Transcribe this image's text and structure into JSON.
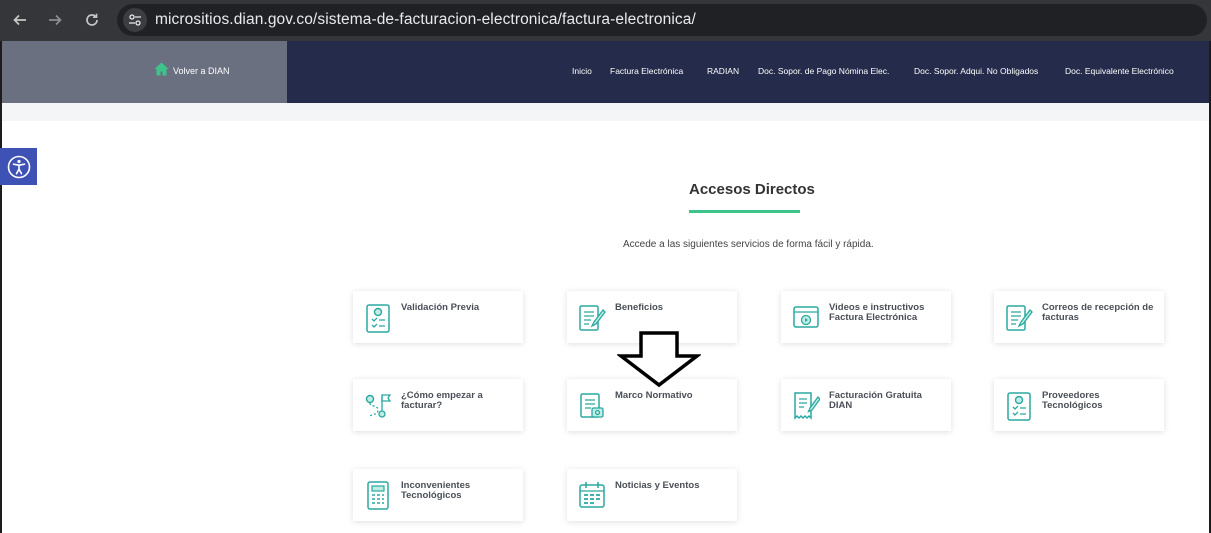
{
  "browser": {
    "url": "micrositios.dian.gov.co/sistema-de-facturacion-electronica/factura-electronica/",
    "back_icon": "arrow-left-icon",
    "forward_icon": "arrow-right-icon",
    "reload_icon": "reload-icon",
    "site_info_icon": "tune-icon"
  },
  "header": {
    "home_label": "Volver a DIAN",
    "nav": [
      "Inicio",
      "Factura Electrónica",
      "RADIAN",
      "Doc. Sopor. de Pago Nómina Elec.",
      "Doc. Sopor. Adqui. No Obligados",
      "Doc. Equivalente Electrónico"
    ]
  },
  "section": {
    "title": "Accesos Directos",
    "intro": "Accede a las siguientes servicios de forma fácil y rápida."
  },
  "cards": [
    {
      "label": "Validación Previa",
      "icon": "checklist-person-icon"
    },
    {
      "label": "Beneficios",
      "icon": "document-pen-icon"
    },
    {
      "label": "Videos e instructivos Factura Electrónica",
      "icon": "video-icon"
    },
    {
      "label": "Correos de recepción de facturas",
      "icon": "document-pen-icon"
    },
    {
      "label": "¿Cómo empezar a facturar?",
      "icon": "route-icon"
    },
    {
      "label": "Marco Normativo",
      "icon": "legal-document-icon"
    },
    {
      "label": "Facturación Gratuita DIAN",
      "icon": "invoice-pen-icon"
    },
    {
      "label": "Proveedores Tecnológicos",
      "icon": "checklist-person-icon"
    },
    {
      "label": "Inconvenientes Tecnológicos",
      "icon": "calculator-icon"
    },
    {
      "label": "Noticias y Eventos",
      "icon": "calendar-icon"
    }
  ],
  "colors": {
    "header_bg": "#252b4a",
    "header_left_bg": "#6b7081",
    "accent_green": "#3cc48a",
    "icon_teal": "#2aa8a0",
    "a11y_bg": "#3e51b5"
  }
}
